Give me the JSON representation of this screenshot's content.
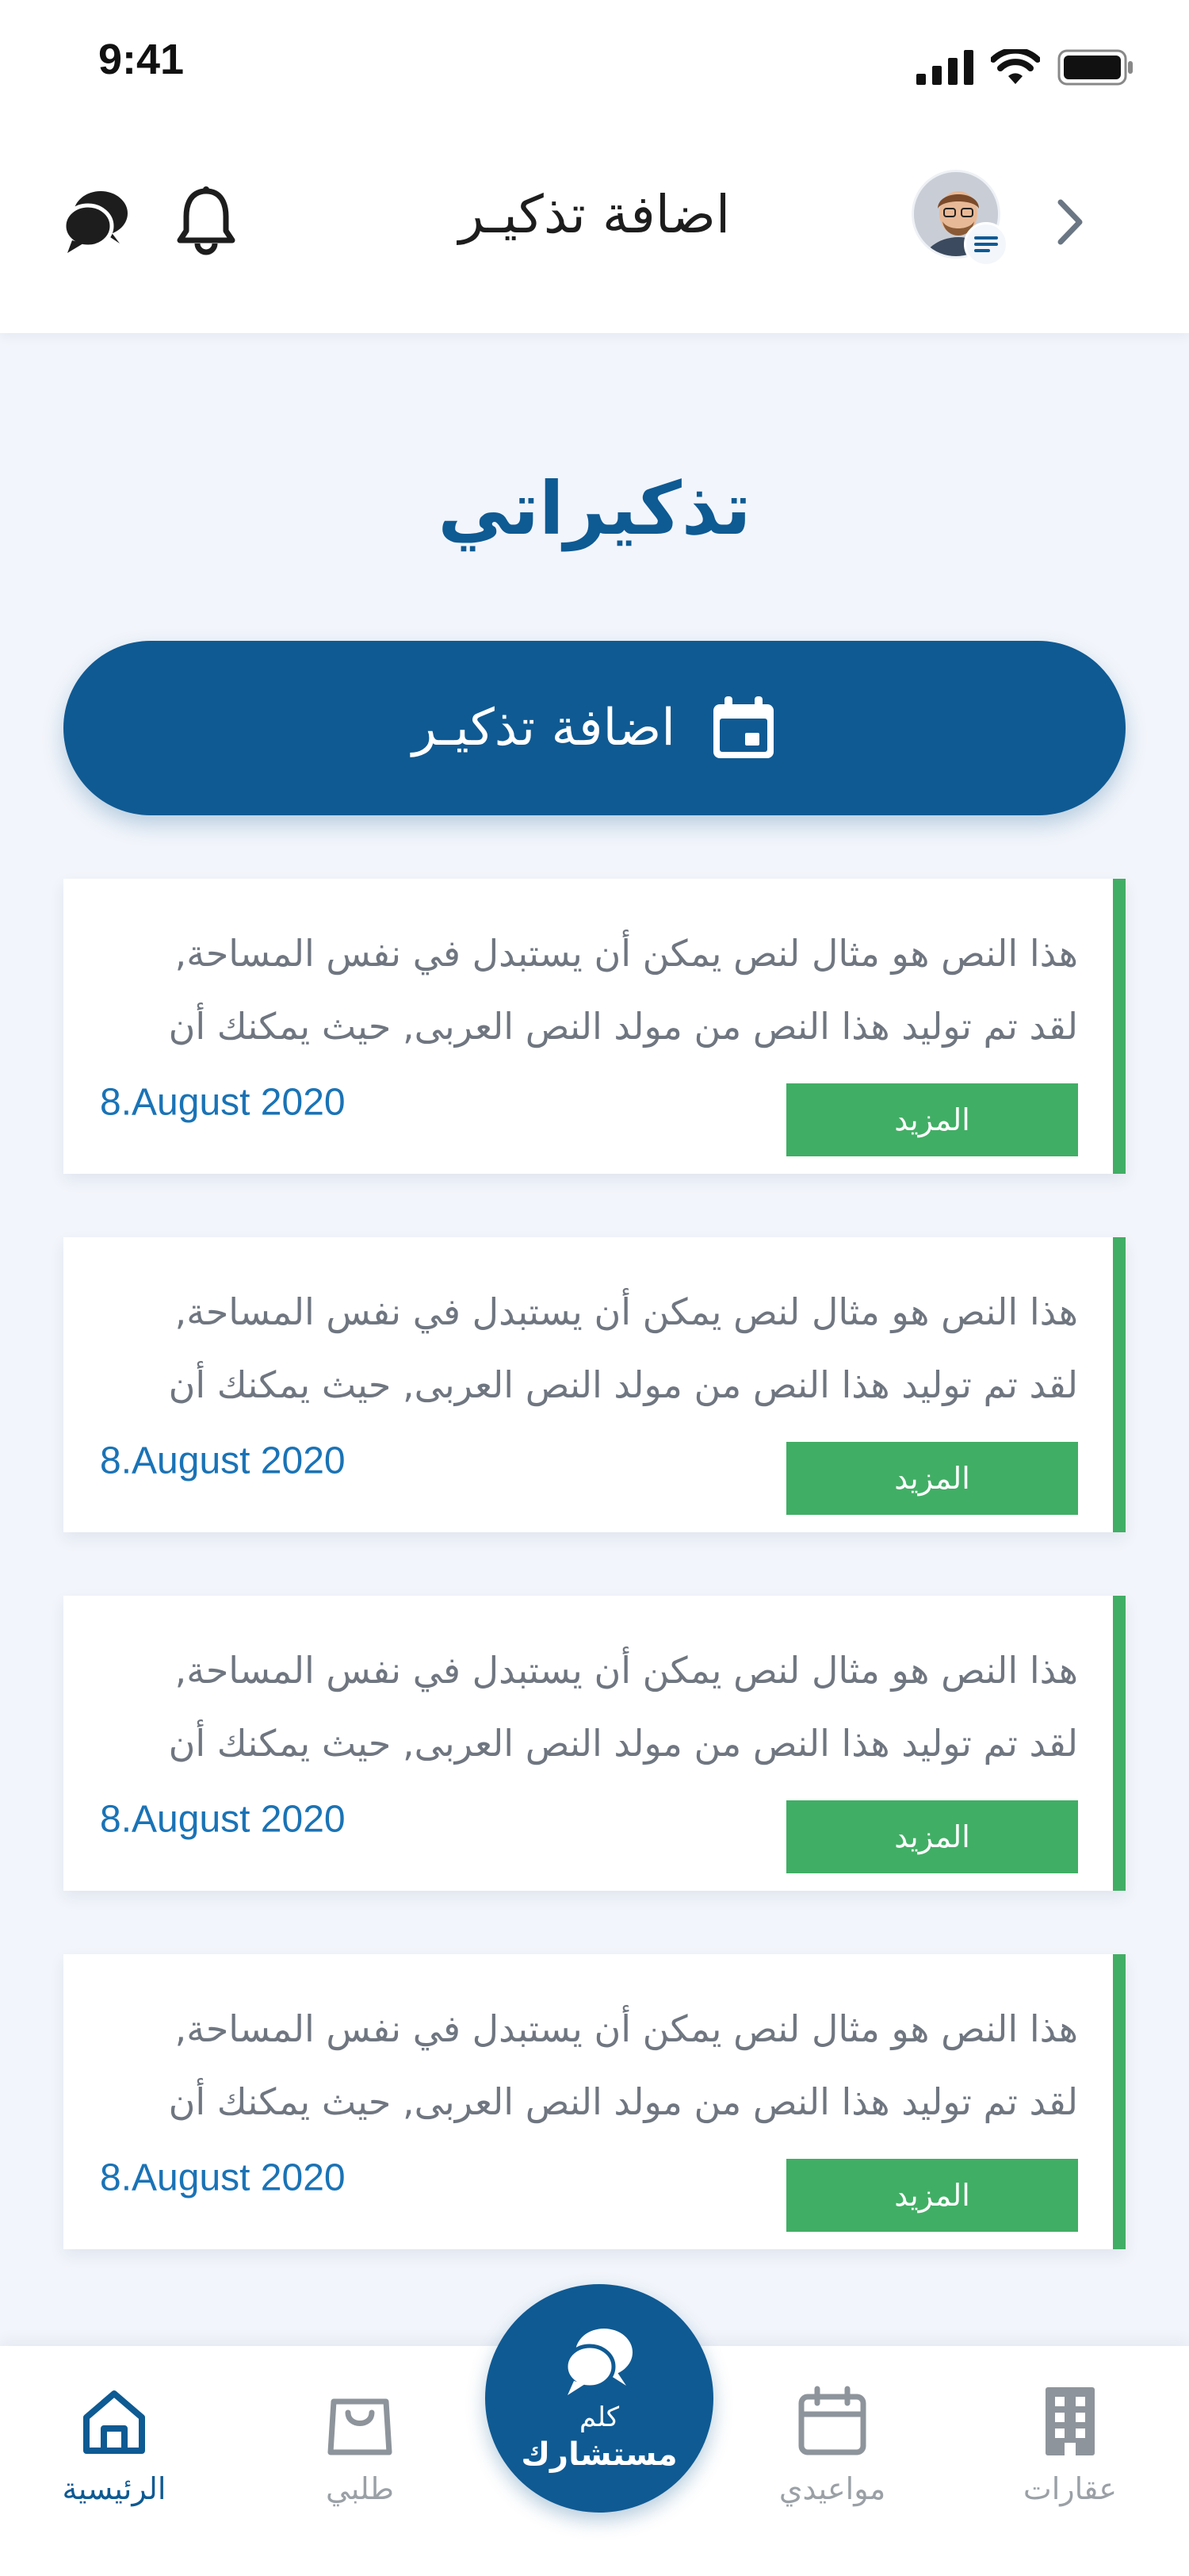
{
  "status_bar": {
    "time": "9:41"
  },
  "header": {
    "title": "اضافة تذكيـر"
  },
  "page": {
    "title": "تذكيراتي"
  },
  "add_button": {
    "label": "اضافة تذكيـر"
  },
  "cards": [
    {
      "line1": "هذا النص هو مثال لنص يمكن أن يستبدل في نفس المساحة,",
      "line2": "لقد تم توليد هذا النص من مولد النص العربى, حيث يمكنك أن",
      "date": "8.August 2020",
      "more": "المزيد"
    },
    {
      "line1": "هذا النص هو مثال لنص يمكن أن يستبدل في نفس المساحة,",
      "line2": "لقد تم توليد هذا النص من مولد النص العربى, حيث يمكنك أن",
      "date": "8.August 2020",
      "more": "المزيد"
    },
    {
      "line1": "هذا النص هو مثال لنص يمكن أن يستبدل في نفس المساحة,",
      "line2": "لقد تم توليد هذا النص من مولد النص العربى, حيث يمكنك أن",
      "date": "8.August 2020",
      "more": "المزيد"
    },
    {
      "line1": "هذا النص هو مثال لنص يمكن أن يستبدل في نفس المساحة,",
      "line2": "لقد تم توليد هذا النص من مولد النص العربى, حيث يمكنك أن",
      "date": "8.August 2020",
      "more": "المزيد"
    }
  ],
  "bottom_nav": {
    "items": [
      {
        "label": "الرئيسية",
        "icon": "home-icon",
        "active": true
      },
      {
        "label": "طلبي",
        "icon": "shopping-bag-icon",
        "active": false
      },
      {
        "label": "مواعيدي",
        "icon": "calendar-icon",
        "active": false
      },
      {
        "label": "عقارات",
        "icon": "building-icon",
        "active": false
      }
    ],
    "center": {
      "line1": "كلم",
      "line2": "مستشارك",
      "icon": "chat-bubbles-icon"
    }
  },
  "colors": {
    "primary": "#0f5a93",
    "accent_green": "#41ae65",
    "date_blue": "#1a73b6",
    "background": "#f2f5fb"
  }
}
